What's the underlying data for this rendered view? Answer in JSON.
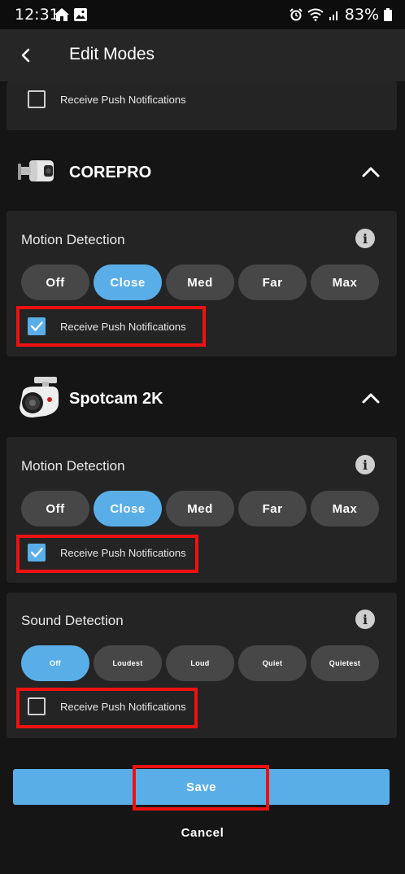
{
  "status_bar": {
    "time": "12:31",
    "battery": "83%"
  },
  "header": {
    "title": "Edit Modes"
  },
  "top_card": {
    "notifications_label": "Receive Push Notifications",
    "notifications_checked": false
  },
  "devices": [
    {
      "name": "COREPRO",
      "motion": {
        "title": "Motion Detection",
        "options": [
          "Off",
          "Close",
          "Med",
          "Far",
          "Max"
        ],
        "selected": "Close",
        "notifications_label": "Receive Push Notifications",
        "notifications_checked": true
      }
    },
    {
      "name": "Spotcam 2K",
      "motion": {
        "title": "Motion Detection",
        "options": [
          "Off",
          "Close",
          "Med",
          "Far",
          "Max"
        ],
        "selected": "Close",
        "notifications_label": "Receive Push Notifications",
        "notifications_checked": true
      },
      "sound": {
        "title": "Sound Detection",
        "options": [
          "Off",
          "Loudest",
          "Loud",
          "Quiet",
          "Quietest"
        ],
        "selected": "Off",
        "notifications_label": "Receive Push Notifications",
        "notifications_checked": false
      }
    }
  ],
  "footer": {
    "save_label": "Save",
    "cancel_label": "Cancel"
  },
  "colors": {
    "accent": "#5aaee7",
    "highlight": "#ee1111",
    "card": "#242424",
    "background": "#151515"
  }
}
